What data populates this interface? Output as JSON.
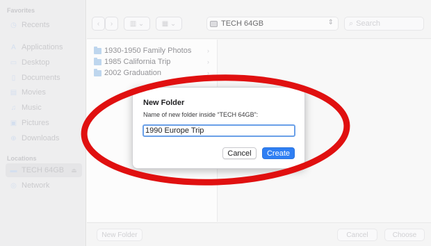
{
  "sidebar": {
    "favorites_heading": "Favorites",
    "favorites": [
      {
        "label": "Recents",
        "icon": "clock-icon"
      },
      {
        "label": "Applications",
        "icon": "applications-icon"
      },
      {
        "label": "Desktop",
        "icon": "desktop-icon"
      },
      {
        "label": "Documents",
        "icon": "document-icon"
      },
      {
        "label": "Movies",
        "icon": "movies-icon"
      },
      {
        "label": "Music",
        "icon": "music-icon"
      },
      {
        "label": "Pictures",
        "icon": "pictures-icon"
      },
      {
        "label": "Downloads",
        "icon": "downloads-icon"
      }
    ],
    "locations_heading": "Locations",
    "locations": [
      {
        "label": "TECH 64GB",
        "icon": "drive-icon",
        "selected": true
      },
      {
        "label": "Network",
        "icon": "network-icon"
      }
    ]
  },
  "toolbar": {
    "location": "TECH 64GB",
    "search_placeholder": "Search"
  },
  "files": [
    {
      "name": "1930-1950 Family Photos"
    },
    {
      "name": "1985 California Trip"
    },
    {
      "name": "2002 Graduation"
    }
  ],
  "bottombar": {
    "new_folder_label": "New Folder",
    "cancel_label": "Cancel",
    "choose_label": "Choose"
  },
  "dialog": {
    "title": "New Folder",
    "prompt": "Name of new folder inside “TECH 64GB”:",
    "input_value": "1990 Europe Trip",
    "cancel_label": "Cancel",
    "create_label": "Create"
  },
  "colors": {
    "accent": "#2f7ff3",
    "annotation": "#e01010"
  }
}
